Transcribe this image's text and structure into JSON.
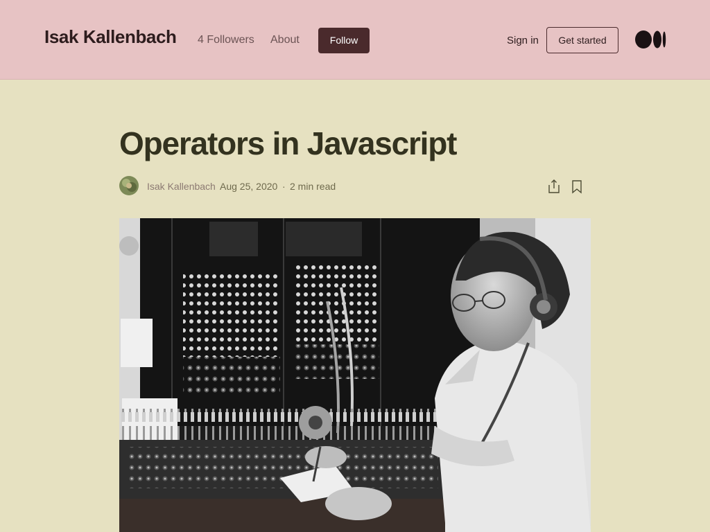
{
  "header": {
    "brand": "Isak Kallenbach",
    "followers": "4 Followers",
    "about": "About",
    "follow": "Follow",
    "sign_in": "Sign in",
    "get_started": "Get started",
    "logo_icon": "medium-logo-icon"
  },
  "article": {
    "title": "Operators in Javascript",
    "author": "Isak Kallenbach",
    "date": "Aug 25, 2020",
    "separator": "·",
    "read_time": "2 min read",
    "share_icon": "share-icon",
    "bookmark_icon": "bookmark-icon",
    "hero_image": "telephone switchboard operator photo"
  },
  "colors": {
    "header_bg": "#e7c3c4",
    "page_bg": "#e6e1c1",
    "follow_bg": "#4a2a2c",
    "title_color": "#33321f"
  }
}
